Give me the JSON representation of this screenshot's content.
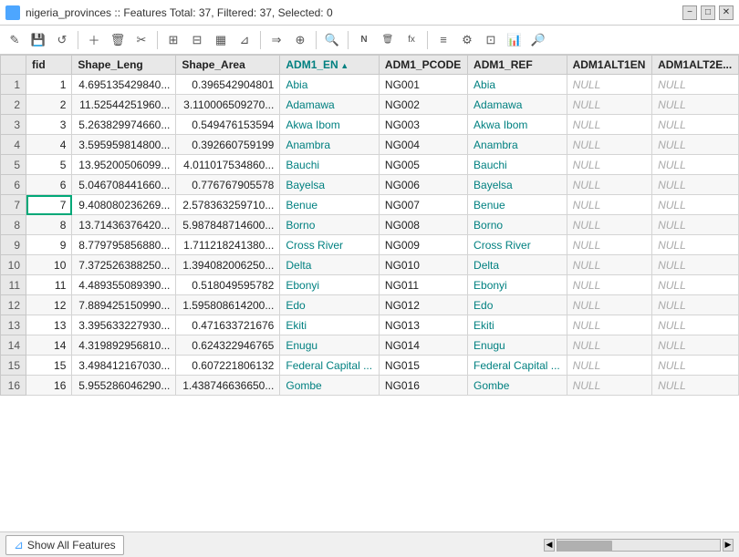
{
  "titleBar": {
    "title": "nigeria_provinces :: Features Total: 37, Filtered: 37, Selected: 0",
    "iconLabel": "table-icon",
    "minBtn": "−",
    "maxBtn": "□",
    "closeBtn": "✕"
  },
  "toolbar": {
    "buttons": [
      {
        "name": "toggle-edit-btn",
        "icon": "✏️",
        "label": "Toggle editing"
      },
      {
        "name": "save-btn",
        "icon": "💾",
        "label": "Save edits"
      },
      {
        "name": "refresh-btn",
        "icon": "↺",
        "label": "Reload"
      },
      {
        "sep": true
      },
      {
        "name": "add-feature-btn",
        "icon": "＋",
        "label": "Add feature"
      },
      {
        "name": "delete-feature-btn",
        "icon": "🗑",
        "label": "Delete selected"
      },
      {
        "name": "cut-btn",
        "icon": "✂",
        "label": "Cut"
      },
      {
        "sep": true
      },
      {
        "name": "select-all-btn",
        "icon": "⊞",
        "label": "Select all"
      },
      {
        "name": "deselect-btn",
        "icon": "⊟",
        "label": "Deselect all"
      },
      {
        "name": "select-rect-btn",
        "icon": "▦",
        "label": "Select by rectangle"
      },
      {
        "name": "filter-btn",
        "icon": "⊟",
        "label": "Filter"
      },
      {
        "sep": true
      },
      {
        "name": "move-to-selected-btn",
        "icon": "→",
        "label": "Move to selected"
      },
      {
        "name": "pan-map-btn",
        "icon": "⊕",
        "label": "Pan map"
      },
      {
        "sep": true
      },
      {
        "name": "search-btn",
        "icon": "🔍",
        "label": "Search"
      },
      {
        "sep": true
      },
      {
        "name": "new-field-btn",
        "icon": "N",
        "label": "New field"
      },
      {
        "name": "delete-field-btn",
        "icon": "D",
        "label": "Delete field"
      },
      {
        "name": "calculator-btn",
        "icon": "fx",
        "label": "Calculator"
      },
      {
        "sep": true
      },
      {
        "name": "conditional-btn",
        "icon": "≡",
        "label": "Conditional formatting"
      },
      {
        "name": "actions-btn",
        "icon": "⚙",
        "label": "Actions"
      },
      {
        "name": "dock-btn",
        "icon": "⊡",
        "label": "Dock"
      },
      {
        "name": "stats-btn",
        "icon": "📊",
        "label": "Statistics"
      },
      {
        "name": "zoom-btn",
        "icon": "🔎",
        "label": "Zoom"
      }
    ]
  },
  "table": {
    "columns": [
      {
        "key": "rownum",
        "label": ""
      },
      {
        "key": "fid",
        "label": "fid"
      },
      {
        "key": "shape_leng",
        "label": "Shape_Leng"
      },
      {
        "key": "shape_area",
        "label": "Shape_Area"
      },
      {
        "key": "adm1_en",
        "label": "ADM1_EN",
        "sorted": "asc"
      },
      {
        "key": "adm1_pcode",
        "label": "ADM1_PCODE"
      },
      {
        "key": "adm1_ref",
        "label": "ADM1_REF"
      },
      {
        "key": "adm1alt1en",
        "label": "ADM1ALT1EN"
      },
      {
        "key": "adm1alt2en",
        "label": "ADM1ALT2E..."
      }
    ],
    "rows": [
      {
        "rownum": "1",
        "fid": "1",
        "shape_leng": "4.695135429840...",
        "shape_area": "0.396542904801",
        "adm1_en": "Abia",
        "adm1_pcode": "NG001",
        "adm1_ref": "Abia",
        "adm1alt1en": "NULL",
        "adm1alt2en": "NULL",
        "selected": false
      },
      {
        "rownum": "2",
        "fid": "2",
        "shape_leng": "11.52544251960...",
        "shape_area": "3.110006509270...",
        "adm1_en": "Adamawa",
        "adm1_pcode": "NG002",
        "adm1_ref": "Adamawa",
        "adm1alt1en": "NULL",
        "adm1alt2en": "NULL",
        "selected": false
      },
      {
        "rownum": "3",
        "fid": "3",
        "shape_leng": "5.263829974660...",
        "shape_area": "0.549476153594",
        "adm1_en": "Akwa Ibom",
        "adm1_pcode": "NG003",
        "adm1_ref": "Akwa Ibom",
        "adm1alt1en": "NULL",
        "adm1alt2en": "NULL",
        "selected": false
      },
      {
        "rownum": "4",
        "fid": "4",
        "shape_leng": "3.595959814800...",
        "shape_area": "0.392660759199",
        "adm1_en": "Anambra",
        "adm1_pcode": "NG004",
        "adm1_ref": "Anambra",
        "adm1alt1en": "NULL",
        "adm1alt2en": "NULL",
        "selected": false
      },
      {
        "rownum": "5",
        "fid": "5",
        "shape_leng": "13.95200506099...",
        "shape_area": "4.011017534860...",
        "adm1_en": "Bauchi",
        "adm1_pcode": "NG005",
        "adm1_ref": "Bauchi",
        "adm1alt1en": "NULL",
        "adm1alt2en": "NULL",
        "selected": false
      },
      {
        "rownum": "6",
        "fid": "6",
        "shape_leng": "5.046708441660...",
        "shape_area": "0.776767905578",
        "adm1_en": "Bayelsa",
        "adm1_pcode": "NG006",
        "adm1_ref": "Bayelsa",
        "adm1alt1en": "NULL",
        "adm1alt2en": "NULL",
        "selected": false
      },
      {
        "rownum": "7",
        "fid": "7",
        "shape_leng": "9.408080236269...",
        "shape_area": "2.578363259710...",
        "adm1_en": "Benue",
        "adm1_pcode": "NG007",
        "adm1_ref": "Benue",
        "adm1alt1en": "NULL",
        "adm1alt2en": "NULL",
        "selected": false,
        "activeCell": "fid"
      },
      {
        "rownum": "8",
        "fid": "8",
        "shape_leng": "13.71436376420...",
        "shape_area": "5.987848714600...",
        "adm1_en": "Borno",
        "adm1_pcode": "NG008",
        "adm1_ref": "Borno",
        "adm1alt1en": "NULL",
        "adm1alt2en": "NULL",
        "selected": false
      },
      {
        "rownum": "9",
        "fid": "9",
        "shape_leng": "8.779795856880...",
        "shape_area": "1.711218241380...",
        "adm1_en": "Cross River",
        "adm1_pcode": "NG009",
        "adm1_ref": "Cross River",
        "adm1alt1en": "NULL",
        "adm1alt2en": "NULL",
        "selected": false
      },
      {
        "rownum": "10",
        "fid": "10",
        "shape_leng": "7.372526388250...",
        "shape_area": "1.394082006250...",
        "adm1_en": "Delta",
        "adm1_pcode": "NG010",
        "adm1_ref": "Delta",
        "adm1alt1en": "NULL",
        "adm1alt2en": "NULL",
        "selected": false
      },
      {
        "rownum": "11",
        "fid": "11",
        "shape_leng": "4.489355089390...",
        "shape_area": "0.518049595782",
        "adm1_en": "Ebonyi",
        "adm1_pcode": "NG011",
        "adm1_ref": "Ebonyi",
        "adm1alt1en": "NULL",
        "adm1alt2en": "NULL",
        "selected": false
      },
      {
        "rownum": "12",
        "fid": "12",
        "shape_leng": "7.889425150990...",
        "shape_area": "1.595808614200...",
        "adm1_en": "Edo",
        "adm1_pcode": "NG012",
        "adm1_ref": "Edo",
        "adm1alt1en": "NULL",
        "adm1alt2en": "NULL",
        "selected": false
      },
      {
        "rownum": "13",
        "fid": "13",
        "shape_leng": "3.395633227930...",
        "shape_area": "0.471633721676",
        "adm1_en": "Ekiti",
        "adm1_pcode": "NG013",
        "adm1_ref": "Ekiti",
        "adm1alt1en": "NULL",
        "adm1alt2en": "NULL",
        "selected": false
      },
      {
        "rownum": "14",
        "fid": "14",
        "shape_leng": "4.319892956810...",
        "shape_area": "0.624322946765",
        "adm1_en": "Enugu",
        "adm1_pcode": "NG014",
        "adm1_ref": "Enugu",
        "adm1alt1en": "NULL",
        "adm1alt2en": "NULL",
        "selected": false
      },
      {
        "rownum": "15",
        "fid": "15",
        "shape_leng": "3.498412167030...",
        "shape_area": "0.607221806132",
        "adm1_en": "Federal Capital ...",
        "adm1_pcode": "NG015",
        "adm1_ref": "Federal Capital ...",
        "adm1alt1en": "NULL",
        "adm1alt2en": "NULL",
        "selected": false
      },
      {
        "rownum": "16",
        "fid": "16",
        "shape_leng": "5.955286046290...",
        "shape_area": "1.438746636650...",
        "adm1_en": "Gombe",
        "adm1_pcode": "NG016",
        "adm1_ref": "Gombe",
        "adm1alt1en": "NULL",
        "adm1alt2en": "NULL",
        "selected": false
      }
    ]
  },
  "bottomBar": {
    "showAllLabel": "Show All Features"
  }
}
